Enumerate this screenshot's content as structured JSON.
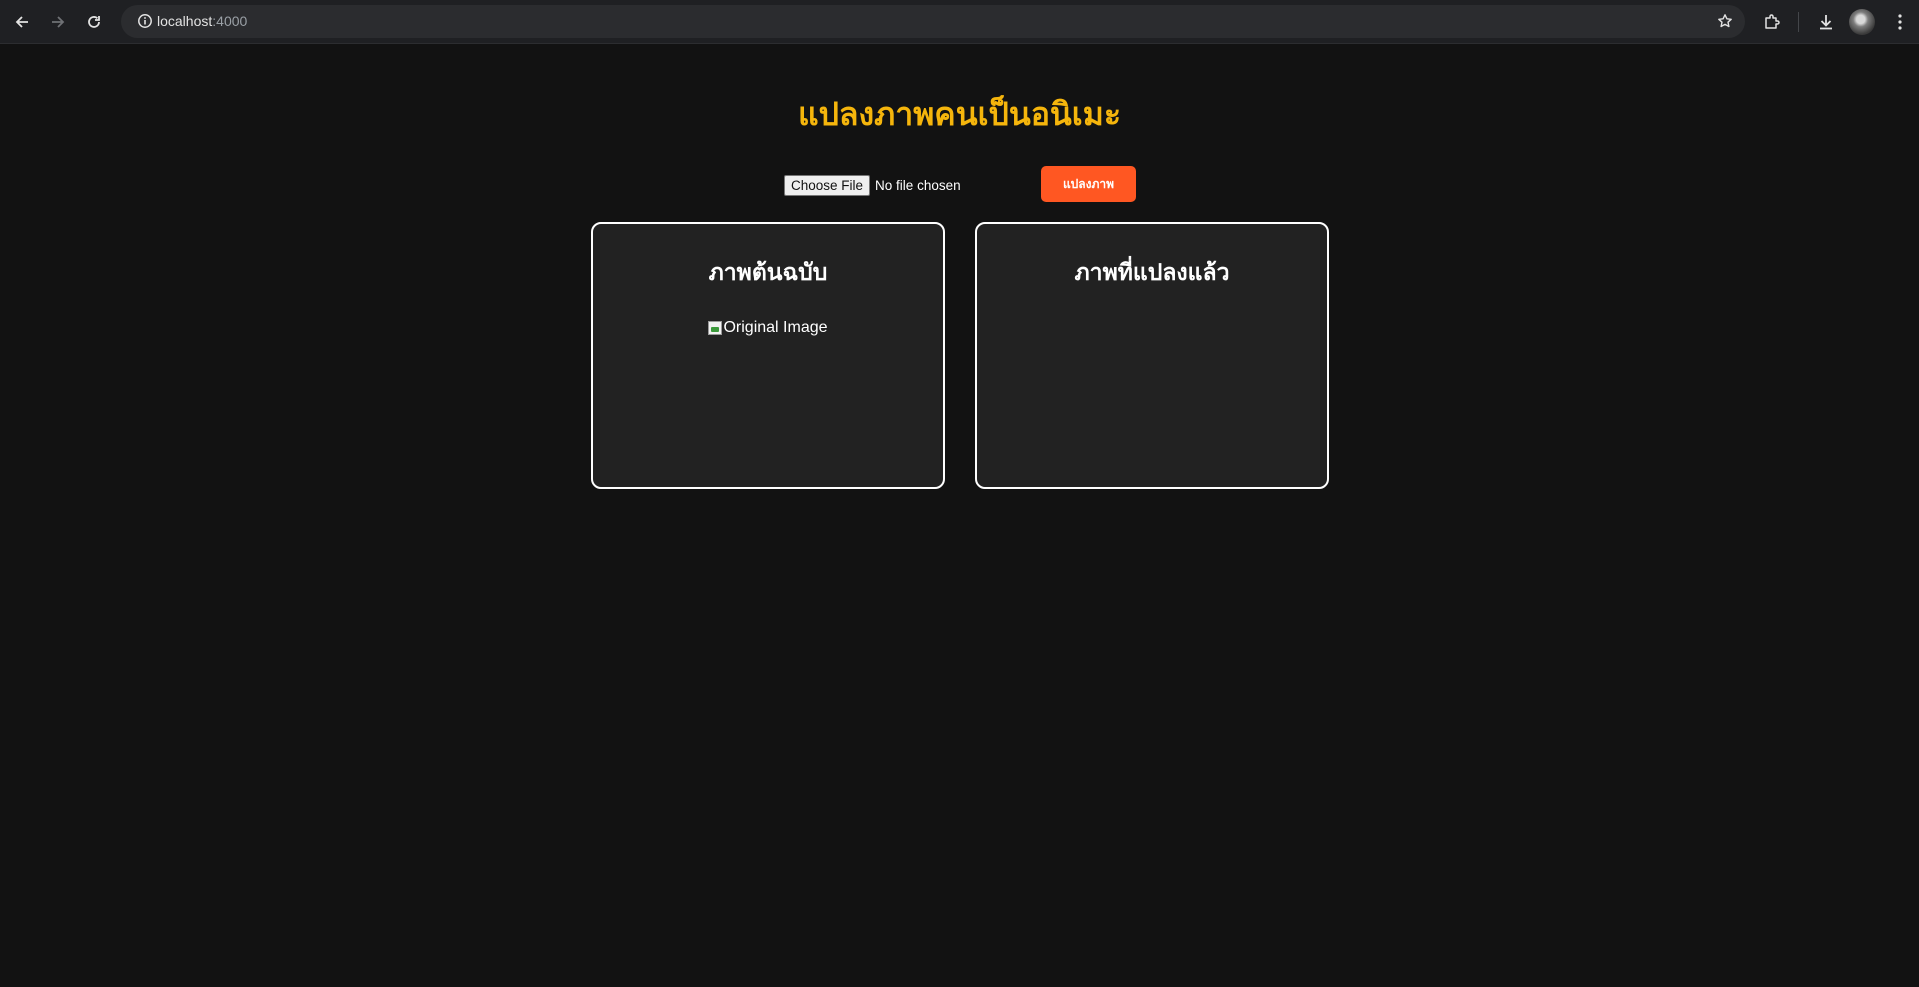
{
  "browser": {
    "url_host": "localhost",
    "url_port": ":4000",
    "icons": [
      "back-icon",
      "forward-icon",
      "reload-icon",
      "site-info-icon",
      "bookmark-star-icon",
      "extensions-icon",
      "download-icon",
      "profile-avatar",
      "menu-kebab-icon"
    ]
  },
  "page": {
    "title": "แปลงภาพคนเป็นอนิเมะ",
    "file_input": {
      "button_label": "Choose File",
      "status": "No file chosen"
    },
    "convert_button": "แปลงภาพ",
    "panels": {
      "original": {
        "heading": "ภาพต้นฉบับ",
        "image_alt": "Original Image"
      },
      "converted": {
        "heading": "ภาพที่แปลงแล้ว"
      }
    }
  },
  "colors": {
    "background": "#121212",
    "title": "#f5b50c",
    "accent_button": "#ff5722",
    "panel_bg": "#222222",
    "panel_border": "#ffffff"
  }
}
